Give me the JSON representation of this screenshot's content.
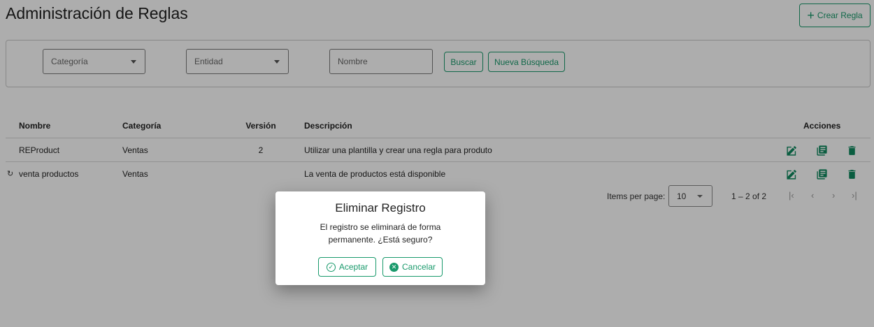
{
  "header": {
    "title": "Administración de Reglas",
    "create_label": "Crear Regla"
  },
  "filters": {
    "category_placeholder": "Categoría",
    "entity_placeholder": "Entidad",
    "name_placeholder": "Nombre",
    "search_label": "Buscar",
    "new_search_label": "Nueva Búsqueda"
  },
  "table": {
    "headers": {
      "name": "Nombre",
      "category": "Categoría",
      "version": "Versión",
      "description": "Descripción",
      "actions": "Acciones"
    },
    "rows": [
      {
        "name": "REProduct",
        "category": "Ventas",
        "version": "2",
        "description": "Utilizar una plantilla y crear una regla para produto"
      },
      {
        "name": "venta productos",
        "category": "Ventas",
        "version": "",
        "description": "La venta de productos está disponible"
      }
    ]
  },
  "paginator": {
    "items_per_page_label": "Items per page:",
    "page_size": "10",
    "range": "1 – 2 of 2"
  },
  "dialog": {
    "title": "Eliminar Registro",
    "message": "El registro se eliminará de forma permanente. ¿Está seguro?",
    "accept_label": "Aceptar",
    "cancel_label": "Cancelar"
  },
  "colors": {
    "accent": "#1a9a6c",
    "icon": "#0f8a5f"
  }
}
